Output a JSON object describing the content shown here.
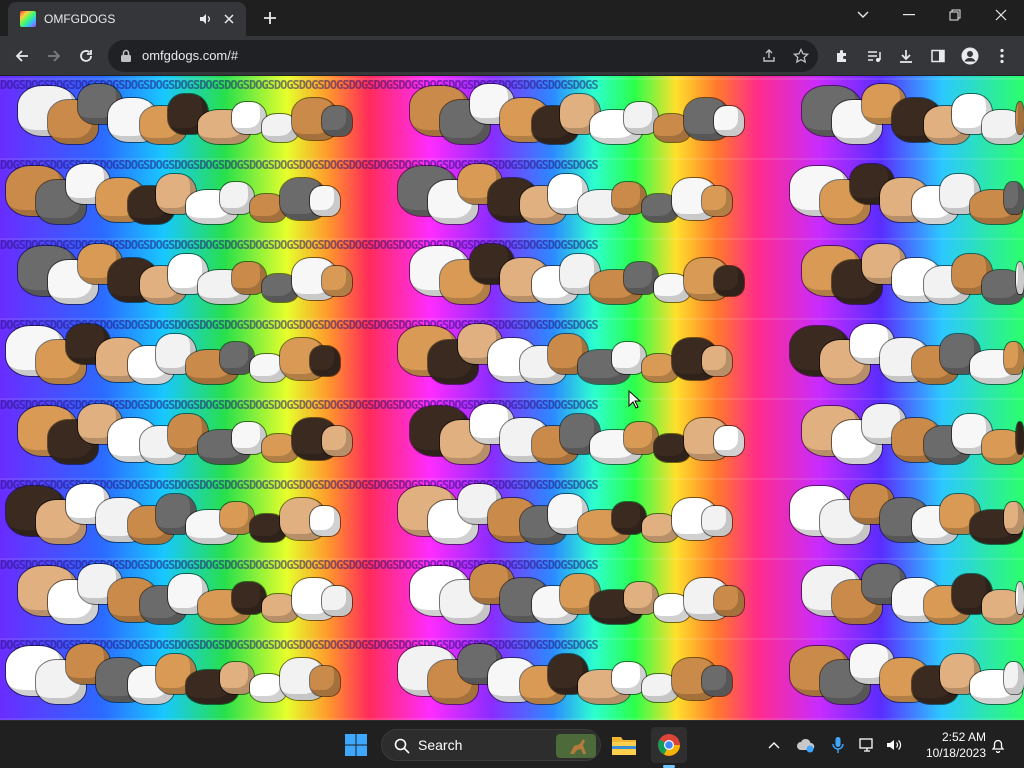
{
  "browser": {
    "tab_title": "OMFGDOGS",
    "url": "omfgdogs.com/#"
  },
  "page": {
    "repeated_text": "DOGSDOGSDOGSDOGSDOGSDOGSDOGSDOGSDOGSDOGSDOGSDOGSDOGSDOGSDOGSDOGSDOGSDOGSDOGSDOGSDOGSDOGSDOGSDOGS"
  },
  "taskbar": {
    "search_label": "Search",
    "time": "2:52 AM",
    "date": "10/18/2023"
  },
  "icons": {
    "audio": "speaker-icon",
    "close": "close-icon",
    "new_tab": "plus-icon",
    "tab_list": "chevron-down-icon",
    "minimize": "minimize-icon",
    "restore": "restore-icon",
    "window_close": "close-icon",
    "back": "back-arrow-icon",
    "forward": "forward-arrow-icon",
    "reload": "reload-icon",
    "lock": "lock-icon",
    "share": "share-icon",
    "bookmark": "star-icon",
    "extensions": "puzzle-icon",
    "media": "media-queue-icon",
    "downloads": "download-icon",
    "side_panel": "side-panel-icon",
    "profile": "profile-icon",
    "menu": "kebab-menu-icon"
  },
  "colors": {
    "titlebar": "#1f1f1f",
    "toolbar": "#35363a",
    "omnibox": "#202124",
    "taskbar": "#202020",
    "accent": "#6fc3ff"
  }
}
